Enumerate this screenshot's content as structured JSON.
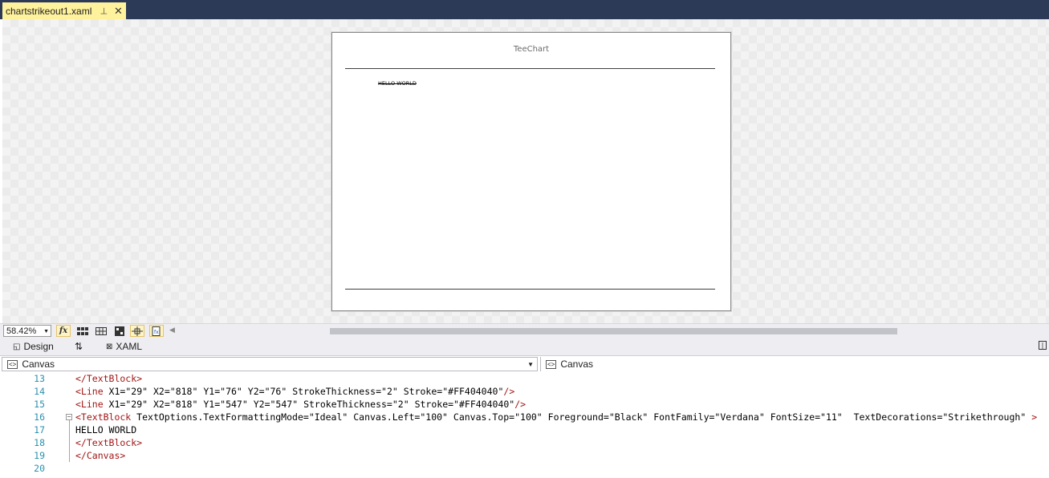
{
  "document_tab": {
    "title": "chartstrikeout1.xaml",
    "pin_icon": "pin-icon",
    "close_icon": "close-icon"
  },
  "canvas": {
    "title": "TeeChart",
    "text": "HELLO WORLD"
  },
  "designer_toolbar": {
    "zoom": "58.42%",
    "buttons": [
      "fx-formula-icon",
      "grid-icon",
      "snap-grid-icon",
      "artboard-background-icon",
      "snap-snaplines-icon",
      "effects-icon"
    ]
  },
  "pane_tabs": {
    "design": "Design",
    "swap": "⇅",
    "xaml": "XAML"
  },
  "nav": {
    "left": "Canvas",
    "right": "Canvas"
  },
  "code": {
    "lines": [
      {
        "no": "13",
        "text": "</TextBlock>"
      },
      {
        "no": "14",
        "text": "<Line X1=\"29\" X2=\"818\" Y1=\"76\" Y2=\"76\" StrokeThickness=\"2\" Stroke=\"#FF404040\"/>"
      },
      {
        "no": "15",
        "text": "<Line X1=\"29\" X2=\"818\" Y1=\"547\" Y2=\"547\" StrokeThickness=\"2\" Stroke=\"#FF404040\"/>"
      },
      {
        "no": "16",
        "text": "<TextBlock TextOptions.TextFormattingMode=\"Ideal\" Canvas.Left=\"100\" Canvas.Top=\"100\" Foreground=\"Black\" FontFamily=\"Verdana\" FontSize=\"11\"  TextDecorations=\"Strikethrough\" >"
      },
      {
        "no": "17",
        "text": "HELLO WORLD"
      },
      {
        "no": "18",
        "text": "</TextBlock>"
      },
      {
        "no": "19",
        "text": "</Canvas>"
      },
      {
        "no": "20",
        "text": ""
      }
    ]
  },
  "colors": {
    "tabstrip": "#2d3a57",
    "active_tab": "#fff29d",
    "xml_tag": "#a31515",
    "xml_attr": "#ff0000",
    "xml_value": "#0000ff",
    "line_number": "#2b91af"
  }
}
